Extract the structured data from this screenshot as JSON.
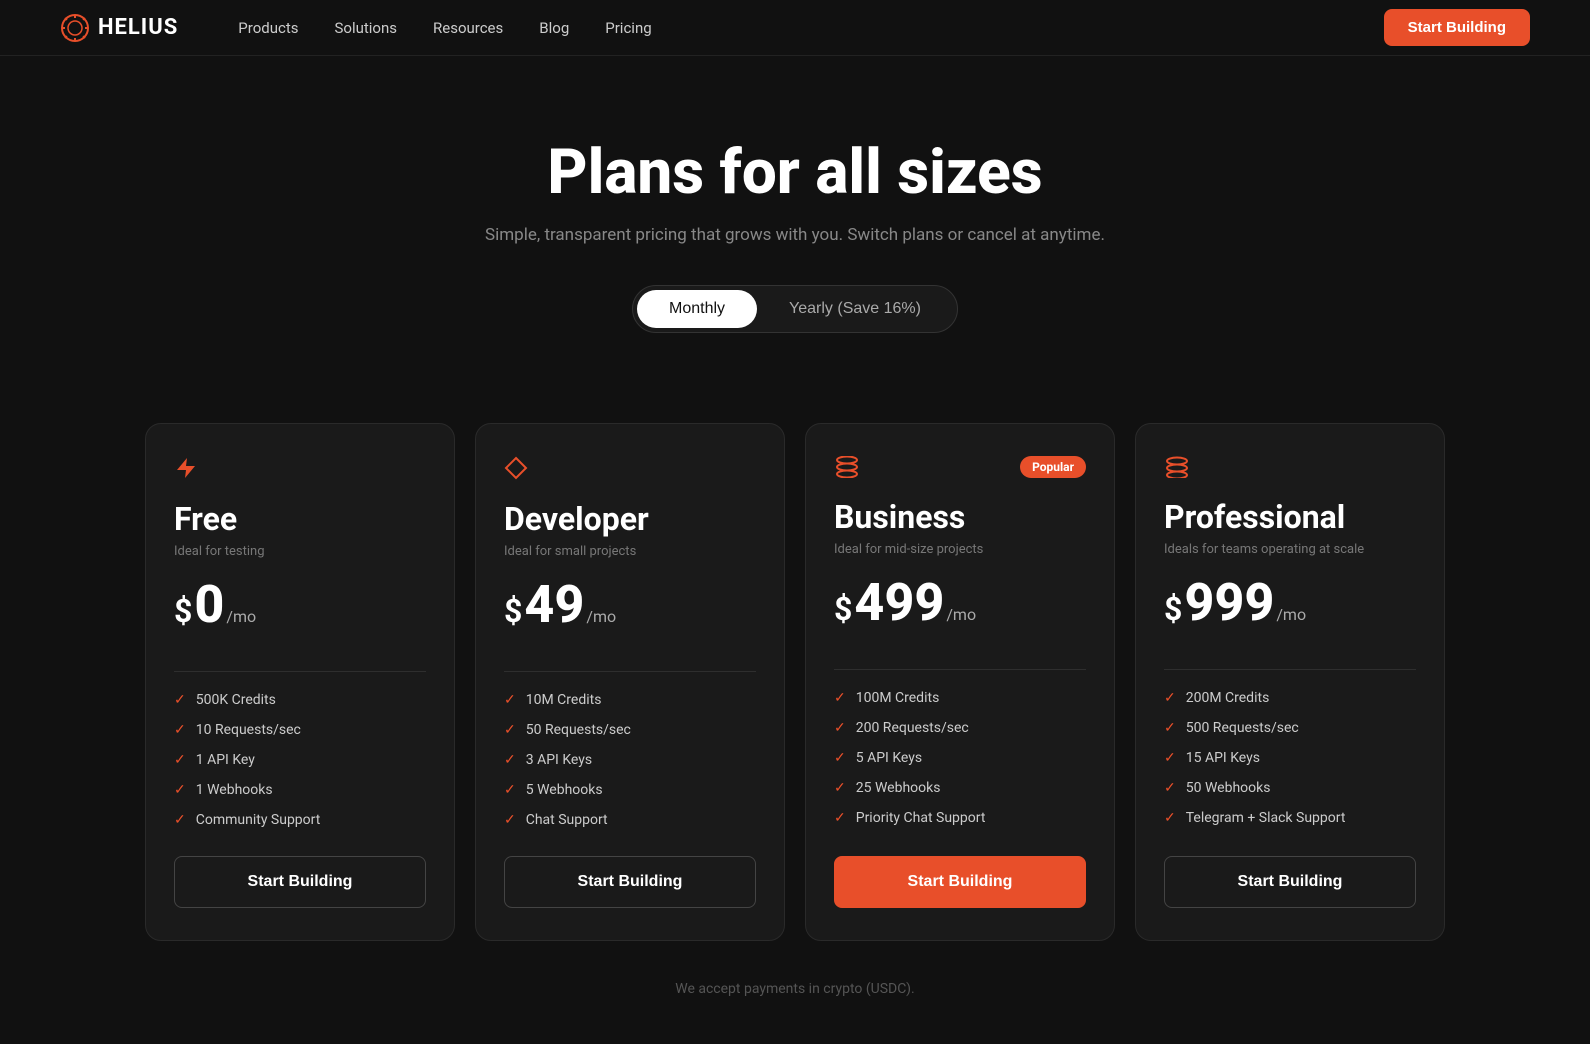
{
  "nav": {
    "logo_text": "HELIUS",
    "links": [
      {
        "label": "Products",
        "id": "products"
      },
      {
        "label": "Solutions",
        "id": "solutions"
      },
      {
        "label": "Resources",
        "id": "resources"
      },
      {
        "label": "Blog",
        "id": "blog"
      },
      {
        "label": "Pricing",
        "id": "pricing"
      }
    ],
    "cta_label": "Start Building"
  },
  "hero": {
    "title": "Plans for all sizes",
    "subtitle": "Simple, transparent pricing that grows with you. Switch plans or cancel at anytime."
  },
  "toggle": {
    "monthly_label": "Monthly",
    "yearly_label": "Yearly (Save 16%)"
  },
  "plans": [
    {
      "id": "free",
      "icon": "bolt",
      "title": "Free",
      "subtitle": "Ideal for testing",
      "price_symbol": "$",
      "price_amount": "0",
      "price_period": "/mo",
      "features": [
        "500K Credits",
        "10 Requests/sec",
        "1 API Key",
        "1 Webhooks",
        "Community Support"
      ],
      "cta_label": "Start Building",
      "is_popular": false,
      "is_primary": false
    },
    {
      "id": "developer",
      "icon": "diamond",
      "title": "Developer",
      "subtitle": "Ideal for small projects",
      "price_symbol": "$",
      "price_amount": "49",
      "price_period": "/mo",
      "features": [
        "10M Credits",
        "50 Requests/sec",
        "3 API Keys",
        "5 Webhooks",
        "Chat Support"
      ],
      "cta_label": "Start Building",
      "is_popular": false,
      "is_primary": false
    },
    {
      "id": "business",
      "icon": "layers",
      "title": "Business",
      "subtitle": "Ideal for mid-size projects",
      "price_symbol": "$",
      "price_amount": "499",
      "price_period": "/mo",
      "features": [
        "100M Credits",
        "200 Requests/sec",
        "5 API Keys",
        "25 Webhooks",
        "Priority Chat Support"
      ],
      "cta_label": "Start Building",
      "is_popular": true,
      "popular_label": "Popular",
      "is_primary": true
    },
    {
      "id": "professional",
      "icon": "layers3",
      "title": "Professional",
      "subtitle": "Ideals for teams operating at scale",
      "price_symbol": "$",
      "price_amount": "999",
      "price_period": "/mo",
      "features": [
        "200M Credits",
        "500 Requests/sec",
        "15 API Keys",
        "50 Webhooks",
        "Telegram + Slack Support"
      ],
      "cta_label": "Start Building",
      "is_popular": false,
      "is_primary": false
    }
  ],
  "footer": {
    "note": "We accept payments in crypto (USDC)."
  },
  "colors": {
    "accent": "#e84f2a",
    "bg": "#111",
    "card_bg": "#1a1a1a"
  }
}
